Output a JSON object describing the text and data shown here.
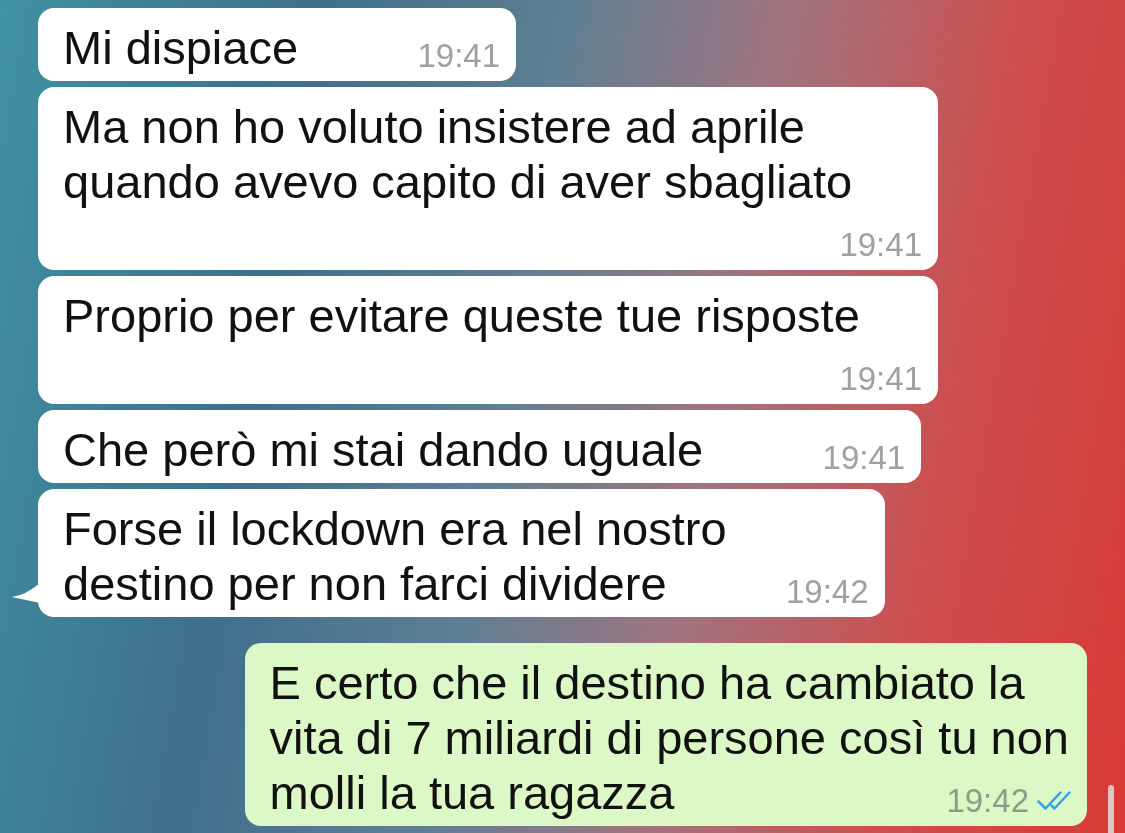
{
  "messages": [
    {
      "kind": "incoming",
      "lines": [
        "Mi dispiace"
      ],
      "time": "19:41",
      "tail": false
    },
    {
      "kind": "incoming",
      "lines": [
        "Ma non ho voluto insistere ad aprile",
        "quando avevo capito di aver sbagliato"
      ],
      "time": "19:41",
      "tail": false
    },
    {
      "kind": "incoming",
      "lines": [
        "Proprio per evitare queste tue risposte"
      ],
      "time": "19:41",
      "tail": false
    },
    {
      "kind": "incoming",
      "lines": [
        "Che però mi stai dando uguale"
      ],
      "time": "19:41",
      "tail": false
    },
    {
      "kind": "incoming",
      "lines": [
        "Forse il lockdown era nel nostro",
        "destino per non farci dividere"
      ],
      "time": "19:42",
      "tail": true
    },
    {
      "kind": "outgoing",
      "lines": [
        "E certo che il destino ha cambiato la",
        "vita di 7 miliardi di persone così tu non",
        "molli la tua ragazza"
      ],
      "time": "19:42",
      "tail": false,
      "read": true
    }
  ]
}
